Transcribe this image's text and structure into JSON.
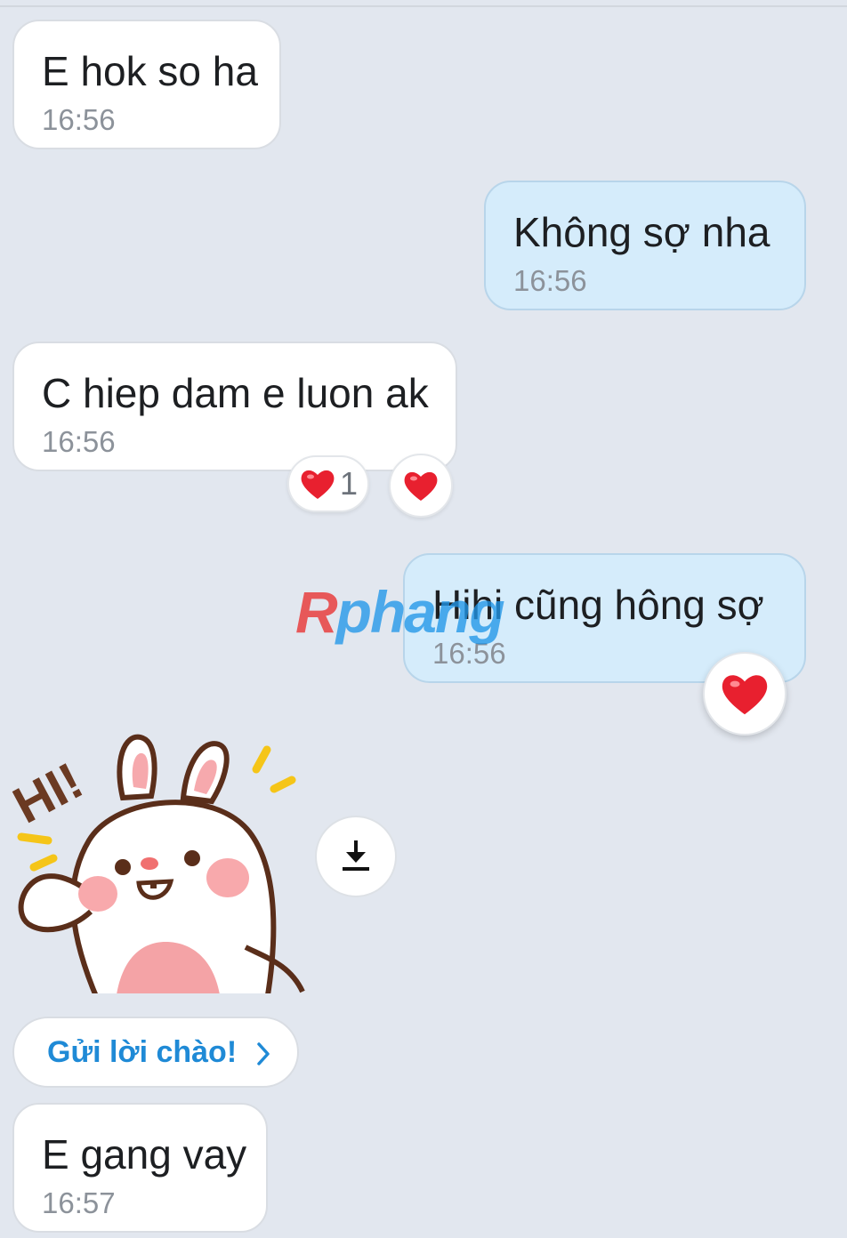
{
  "messages": [
    {
      "text": "E hok so ha",
      "time": "16:56",
      "dir": "in"
    },
    {
      "text": "Không sợ nha",
      "time": "16:56",
      "dir": "out"
    },
    {
      "text": "C hiep dam e luon ak",
      "time": "16:56",
      "dir": "in",
      "reaction_count": "1"
    },
    {
      "text": "Hihi cũng hông sợ",
      "time": "16:56",
      "dir": "out"
    },
    {
      "text": "E gang vay",
      "time": "16:57",
      "dir": "in"
    }
  ],
  "sticker": {
    "text": "HI!"
  },
  "greeting": {
    "label": "Gửi lời chào!",
    "icon": "chevron-right-icon"
  },
  "download": {
    "icon": "download-icon"
  },
  "watermark": {
    "first_letter": "R",
    "rest": "phang"
  },
  "colors": {
    "background": "#e2e7ef",
    "incoming_bubble": "#ffffff",
    "outgoing_bubble": "#d5ecfb",
    "heart": "#e8202f",
    "link": "#1f8ad6"
  }
}
